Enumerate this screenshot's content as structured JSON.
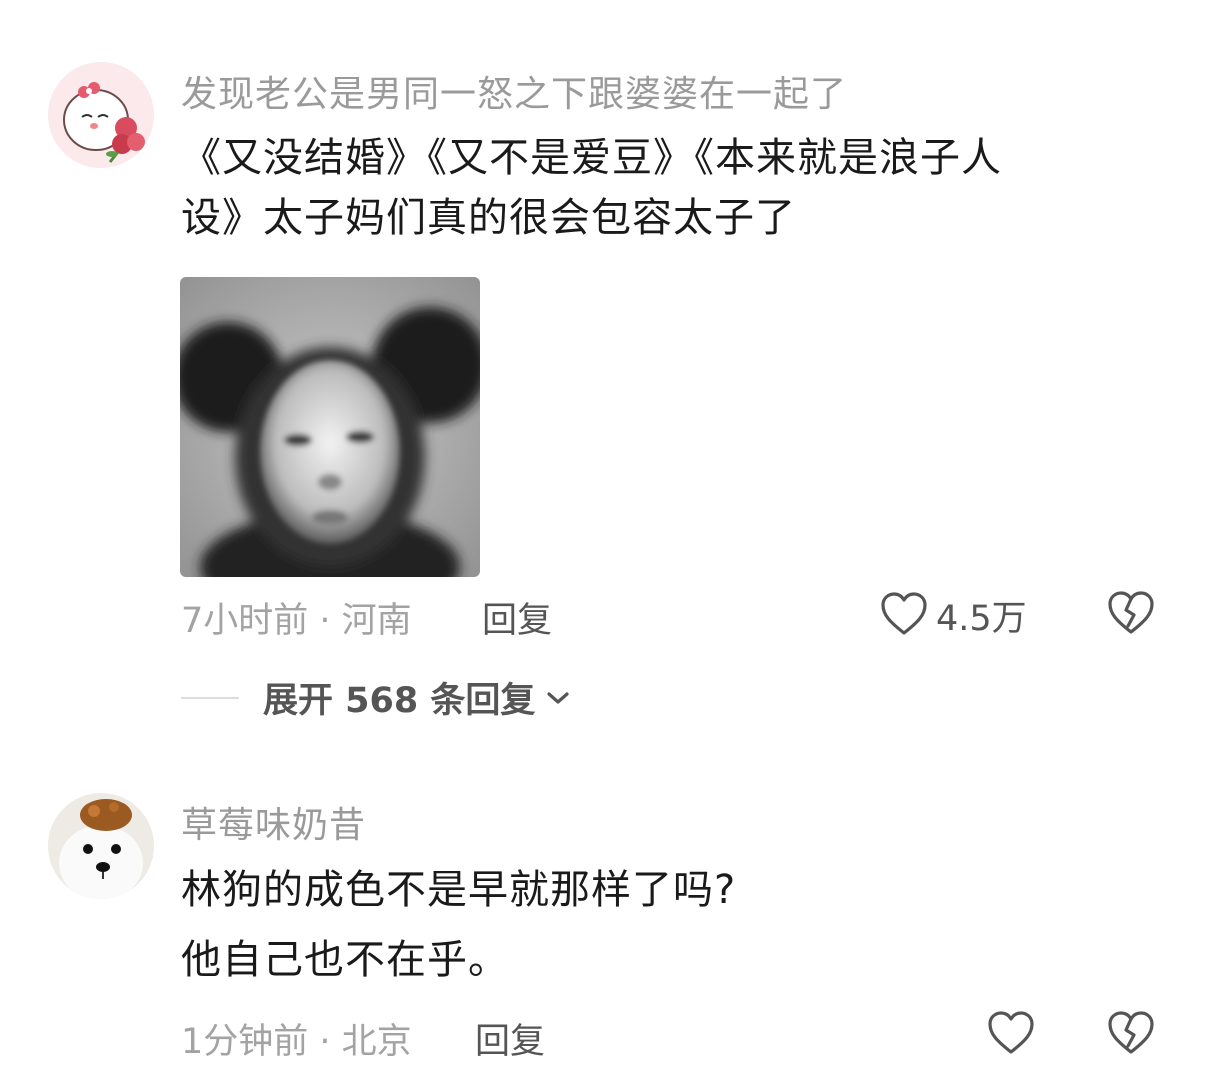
{
  "comments": [
    {
      "username": "发现老公是男同一怒之下跟婆婆在一起了",
      "content_lines": [
        "《又没结婚》《又不是爱豆》《本来就是浪子人",
        "设》太子妈们真的很会包容太子了"
      ],
      "time_location": "7小时前 · 河南",
      "reply_label": "回复",
      "like_count": "4.5万",
      "expand_label": "展开 568 条回复"
    },
    {
      "username": "草莓味奶昔",
      "content_lines": [
        "林狗的成色不是早就那样了吗?",
        "他自己也不在乎。"
      ],
      "time_location": "1分钟前 · 北京",
      "reply_label": "回复"
    }
  ],
  "icons": {
    "like": "heart-outline-icon",
    "dislike": "broken-heart-icon",
    "expand": "chevron-down-icon"
  },
  "colors": {
    "username": "#9a9a9a",
    "content": "#1a1a1a",
    "meta": "#a3a3a3",
    "action": "#555555"
  }
}
